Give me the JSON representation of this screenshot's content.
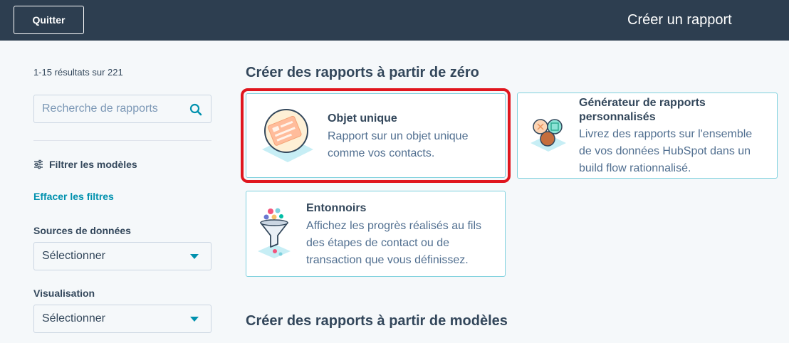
{
  "header": {
    "quit_label": "Quitter",
    "title": "Créer un rapport"
  },
  "sidebar": {
    "results_text": "1-15 résultats sur 221",
    "search_placeholder": "Recherche de rapports",
    "filter_title": "Filtrer les modèles",
    "clear_filters": "Effacer les filtres",
    "data_sources_label": "Sources de données",
    "data_sources_value": "Sélectionner",
    "visualization_label": "Visualisation",
    "visualization_value": "Sélectionner"
  },
  "main": {
    "section_scratch": "Créer des rapports à partir de zéro",
    "section_templates": "Créer des rapports à partir de modèles",
    "cards": [
      {
        "title": "Objet unique",
        "desc_line1": "Rapport sur un objet unique",
        "desc_line2": "comme vos contacts.",
        "icon": "single-object-icon"
      },
      {
        "title_line1": "Générateur de rapports",
        "title_line2": "personnalisés",
        "desc_line1": "Livrez des rapports sur l'ensemble",
        "desc_line2": "de vos données HubSpot dans un",
        "desc_line3": "build flow rationnalisé.",
        "icon": "custom-report-builder-icon"
      },
      {
        "title": "Entonnoirs",
        "desc_line1": "Affichez les progrès réalisés au fils",
        "desc_line2": "des étapes de contact ou de",
        "desc_line3": "transaction que vous définissez.",
        "icon": "funnel-icon"
      }
    ]
  },
  "colors": {
    "header_bg": "#2d3e50",
    "accent": "#0091ae",
    "card_border": "#7fd1de",
    "highlight": "#e0161e"
  }
}
